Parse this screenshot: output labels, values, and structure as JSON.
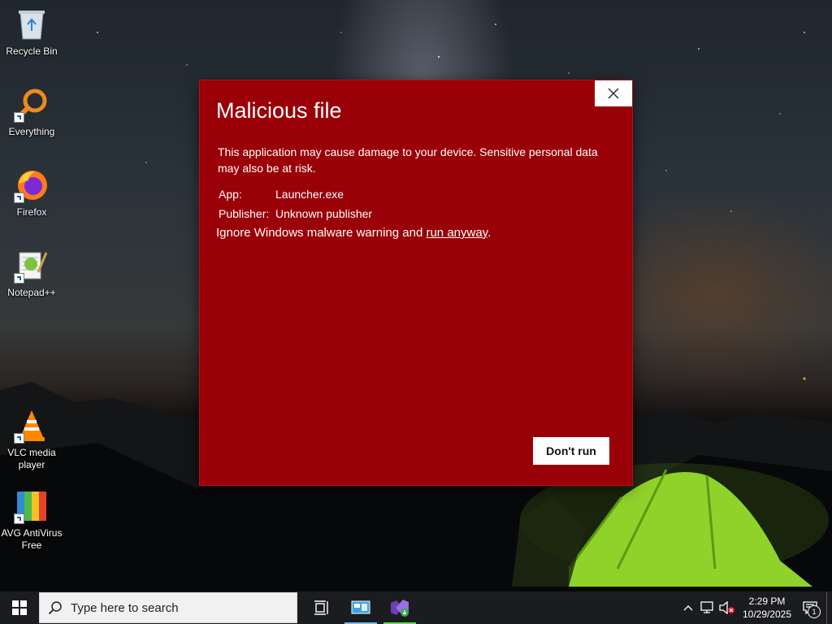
{
  "desktop": {
    "icons": [
      {
        "label": "Recycle Bin",
        "icon": "recycle-bin-icon"
      },
      {
        "label": "Everything",
        "icon": "everything-search-icon"
      },
      {
        "label": "Firefox",
        "icon": "firefox-icon"
      },
      {
        "label": "Notepad++",
        "icon": "notepad-plus-plus-icon"
      },
      {
        "label": "VLC media player",
        "icon": "vlc-icon"
      },
      {
        "label": "AVG AntiVirus Free",
        "icon": "avg-antivirus-icon"
      }
    ]
  },
  "dialog": {
    "title": "Malicious file",
    "message": "This application may cause damage to your device. Sensitive personal data may also be at risk.",
    "app_label": "App:",
    "app_value": "Launcher.exe",
    "publisher_label": "Publisher:",
    "publisher_value": "Unknown publisher",
    "ignore_text": "Ignore Windows malware warning and ",
    "run_link": "run anyway",
    "ignore_suffix": ".",
    "dont_run_label": "Don't run",
    "background_color": "#9a0007"
  },
  "taskbar": {
    "search_placeholder": "Type here to search",
    "time": "2:29 PM",
    "date": "10/29/2025",
    "notification_count": "1"
  }
}
